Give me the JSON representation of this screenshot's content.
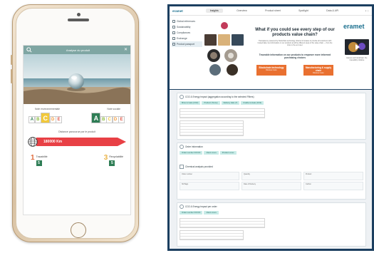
{
  "phone": {
    "app_bar": {
      "title": "Analyse du produit"
    },
    "ratings": {
      "environmental_label": "Note environnementale",
      "social_label": "Note sociale",
      "environmental_letters": [
        "A",
        "B",
        "C",
        "D",
        "E"
      ],
      "environmental_selected": "C",
      "social_letters": [
        "A",
        "B",
        "C",
        "D",
        "E"
      ],
      "social_selected": "A"
    },
    "distance": {
      "label": "Distance parcourue par le produit",
      "value": "180000 Km"
    },
    "facts": [
      {
        "number": "1",
        "label": "Tracabilité",
        "score": "5"
      },
      {
        "number": "3",
        "label": "Recyclabilité",
        "score": "5"
      }
    ]
  },
  "colors": {
    "teal": "#7fa6a3",
    "rating_a": "#2e7d55",
    "rating_b": "#8dbb3f",
    "rating_c": "#f1c83a",
    "rating_d": "#f39a3b",
    "rating_e": "#e05a4a",
    "distance_red": "#e84045",
    "monitor_frame": "#1c3f60",
    "accent_orange": "#e97030",
    "chip_teal": "#c9ece8"
  },
  "desktop": {
    "logo": "eramet",
    "tabs": [
      "Insights",
      "Overview",
      "Product sheet",
      "Spotlight",
      "Data & API"
    ],
    "active_tab": "Insights",
    "sidebar": [
      "Global references",
      "Sustainability",
      "Compliances",
      "Exchange",
      "Product passport"
    ],
    "hero": {
      "title": "What if you could see every step of our products value chain?",
      "body": "Transparency powered by blockchain technology. Eramet innovates to provide all customers with trusted data. Get information on our products at all the different steps of the value chain — from the mine to the end user.",
      "subtitle": "Traceable information on our products to empower more informed purchasing choices",
      "cta_left": "Blockchain technology",
      "cta_left_sub": "Discover more",
      "cta_right": "Manufacturing & supply chain",
      "cta_right_sub": "Discover more"
    },
    "brand": "eramet",
    "video_caption": "Eramet and blockchain: the traceability initiative",
    "card1": {
      "title": "CO2 & Energy impact (aggregation according to the selected Filters)",
      "chips": [
        "Mine to Gate (CO2)",
        "Product (Tonne)",
        "Delivery date (?)",
        "Cradle-to-Gate (CO2)"
      ]
    },
    "card2": {
      "title": "Order information",
      "chips": [
        "Order number XXXXX",
        "Client xxxxx",
        "Product xxxxx"
      ],
      "subtitle": "Chemical analysis provided",
      "kpis": [
        "Order number",
        "Quantity",
        "Product",
        "Nb Bags",
        "Date of Delivery",
        "Carbon"
      ]
    },
    "card3": {
      "title": "CO2 & Energy impact per order",
      "chips": [
        "Order number XXXXX",
        "Client xxxxx"
      ]
    }
  }
}
